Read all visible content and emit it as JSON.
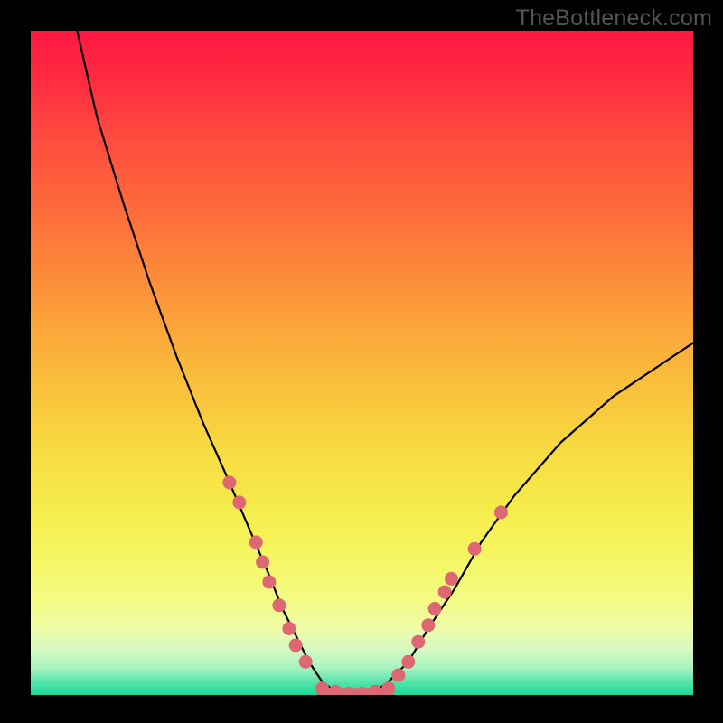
{
  "watermark": "TheBottleneck.com",
  "chart_data": {
    "type": "line",
    "title": "",
    "xlabel": "",
    "ylabel": "",
    "xlim": [
      0,
      100
    ],
    "ylim": [
      0,
      100
    ],
    "series": [
      {
        "name": "bottleneck-curve",
        "x": [
          7,
          10,
          14,
          18,
          22,
          26,
          30,
          33,
          36,
          38,
          40,
          42,
          44,
          46,
          48,
          50,
          52,
          54,
          57,
          60,
          64,
          68,
          73,
          80,
          88,
          100
        ],
        "y": [
          100,
          87,
          74,
          62,
          51,
          41,
          32,
          25,
          18,
          13,
          9,
          5,
          2,
          0.5,
          0,
          0,
          0.5,
          2,
          5,
          10,
          16,
          23,
          30,
          38,
          45,
          53
        ]
      }
    ],
    "markers": {
      "name": "highlight-dots",
      "points": [
        {
          "x": 30.0,
          "y": 32.0
        },
        {
          "x": 31.5,
          "y": 29.0
        },
        {
          "x": 34.0,
          "y": 23.0
        },
        {
          "x": 35.0,
          "y": 20.0
        },
        {
          "x": 36.0,
          "y": 17.0
        },
        {
          "x": 37.5,
          "y": 13.5
        },
        {
          "x": 39.0,
          "y": 10.0
        },
        {
          "x": 40.0,
          "y": 7.5
        },
        {
          "x": 41.5,
          "y": 5.0
        },
        {
          "x": 44.0,
          "y": 1.0
        },
        {
          "x": 46.0,
          "y": 0.5
        },
        {
          "x": 48.0,
          "y": 0.2
        },
        {
          "x": 50.0,
          "y": 0.2
        },
        {
          "x": 52.0,
          "y": 0.5
        },
        {
          "x": 54.0,
          "y": 1.0
        },
        {
          "x": 55.5,
          "y": 3.0
        },
        {
          "x": 57.0,
          "y": 5.0
        },
        {
          "x": 58.5,
          "y": 8.0
        },
        {
          "x": 60.0,
          "y": 10.5
        },
        {
          "x": 61.0,
          "y": 13.0
        },
        {
          "x": 62.5,
          "y": 15.5
        },
        {
          "x": 63.5,
          "y": 17.5
        },
        {
          "x": 67.0,
          "y": 22.0
        },
        {
          "x": 71.0,
          "y": 27.5
        }
      ]
    }
  }
}
